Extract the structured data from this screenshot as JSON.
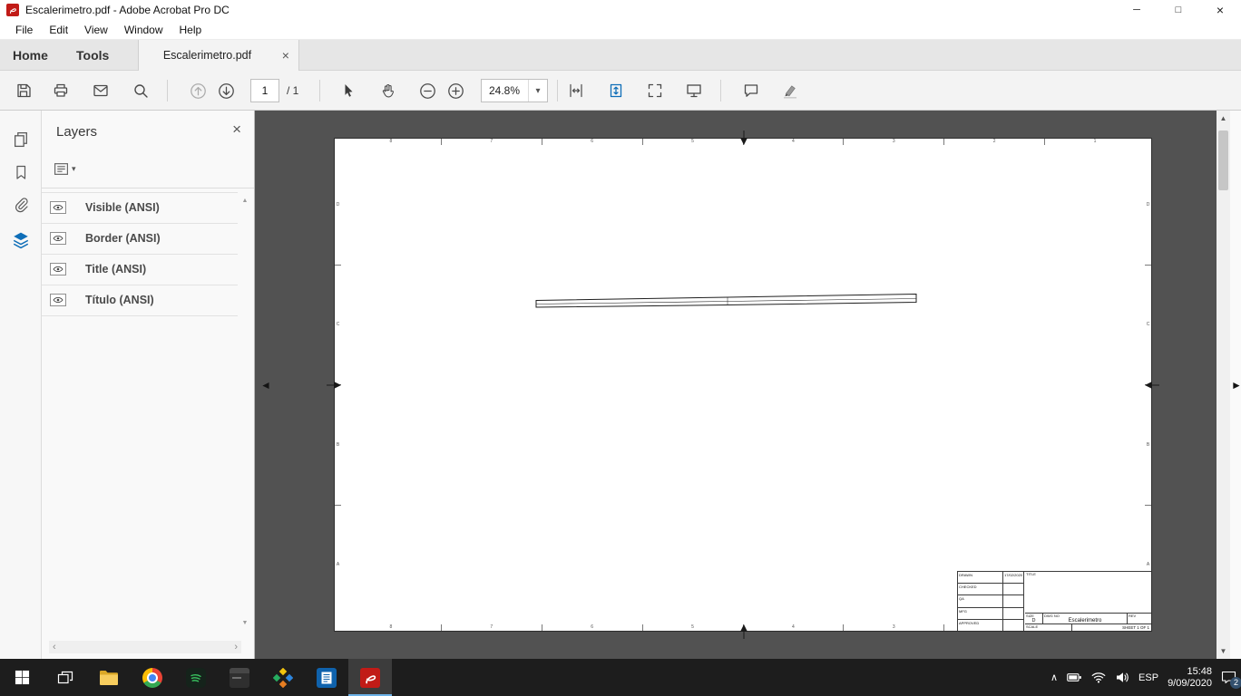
{
  "window": {
    "title": "Escalerimetro.pdf - Adobe Acrobat Pro DC"
  },
  "glyphs": {
    "minimize": "─",
    "maximize": "□",
    "close": "×",
    "caret_down": "▾",
    "chevron_left": "‹",
    "chevron_right": "›",
    "tri_up": "▲",
    "tri_down": "▼",
    "tri_left": "◄",
    "tri_right": "►",
    "chevron_up": "∧"
  },
  "menu": {
    "items": [
      "File",
      "Edit",
      "View",
      "Window",
      "Help"
    ]
  },
  "tabs": {
    "home": "Home",
    "tools": "Tools",
    "document": "Escalerimetro.pdf"
  },
  "toolbar": {
    "page_current": "1",
    "page_total": "/ 1",
    "zoom_value": "24.8%"
  },
  "layers_panel": {
    "title": "Layers",
    "items": [
      {
        "label": "Visible (ANSI)"
      },
      {
        "label": "Border (ANSI)"
      },
      {
        "label": "Title (ANSI)"
      },
      {
        "label": "Título (ANSI)"
      }
    ]
  },
  "page": {
    "zones": {
      "cols": [
        "8",
        "7",
        "6",
        "5",
        "4",
        "3",
        "2",
        "1"
      ],
      "rows": [
        "D",
        "C",
        "B",
        "A"
      ]
    }
  },
  "title_block": {
    "drawn_label": "DRAWN",
    "drawn_date": "17/02/2020",
    "checked_label": "CHECKED",
    "qa_label": "QA",
    "mfg_label": "MFG",
    "approved_label": "APPROVED",
    "title_label": "TITLE",
    "size_label": "SIZE",
    "size_value": "D",
    "dwg_label": "DWG NO",
    "dwg_value": "Escalerimetro",
    "rev_label": "REV",
    "scale_label": "SCALE",
    "sheet_value": "SHEET 1 OF 1"
  },
  "taskbar": {
    "language": "ESP",
    "time": "15:48",
    "date": "9/09/2020",
    "badge": "2"
  }
}
